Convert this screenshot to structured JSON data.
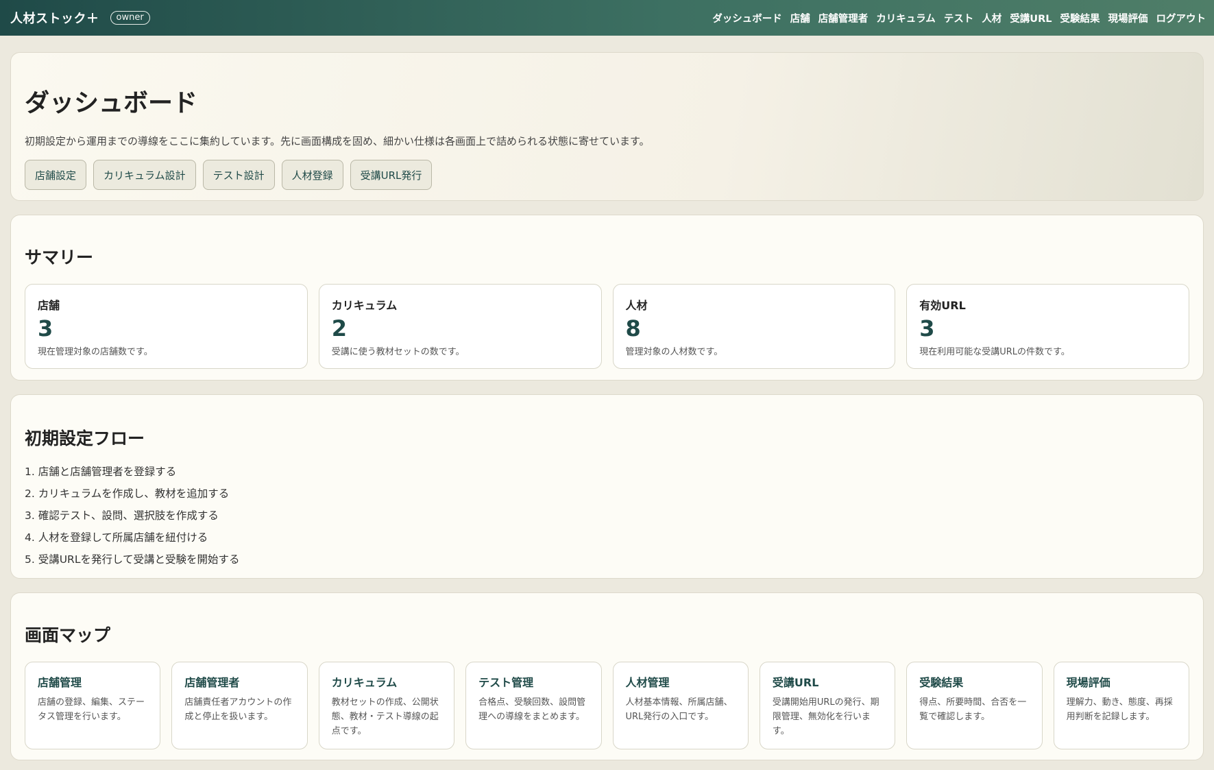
{
  "app": {
    "name": "人材ストック＋",
    "role": "owner"
  },
  "nav": [
    "ダッシュボード",
    "店舗",
    "店舗管理者",
    "カリキュラム",
    "テスト",
    "人材",
    "受講URL",
    "受験結果",
    "現場評価",
    "ログアウト"
  ],
  "hero": {
    "title": "ダッシュボード",
    "description": "初期設定から運用までの導線をここに集約しています。先に画面構成を固め、細かい仕様は各画面上で詰められる状態に寄せています。",
    "actions": [
      "店舗設定",
      "カリキュラム設計",
      "テスト設計",
      "人材登録",
      "受講URL発行"
    ]
  },
  "summary": {
    "title": "サマリー",
    "stats": [
      {
        "label": "店舗",
        "value": "3",
        "note": "現在管理対象の店舗数です。"
      },
      {
        "label": "カリキュラム",
        "value": "2",
        "note": "受講に使う教材セットの数です。"
      },
      {
        "label": "人材",
        "value": "8",
        "note": "管理対象の人材数です。"
      },
      {
        "label": "有効URL",
        "value": "3",
        "note": "現在利用可能な受講URLの件数です。"
      }
    ]
  },
  "flow": {
    "title": "初期設定フロー",
    "steps": [
      "1. 店舗と店舗管理者を登録する",
      "2. カリキュラムを作成し、教材を追加する",
      "3. 確認テスト、設問、選択肢を作成する",
      "4. 人材を登録して所属店舗を紐付ける",
      "5. 受講URLを発行して受講と受験を開始する"
    ]
  },
  "screen_map": {
    "title": "画面マップ",
    "cards": [
      {
        "title": "店舗管理",
        "desc": "店舗の登録、編集、ステータス管理を行います。"
      },
      {
        "title": "店舗管理者",
        "desc": "店舗責任者アカウントの作成と停止を扱います。"
      },
      {
        "title": "カリキュラム",
        "desc": "教材セットの作成、公開状態、教材・テスト導線の起点です。"
      },
      {
        "title": "テスト管理",
        "desc": "合格点、受験回数、設問管理への導線をまとめます。"
      },
      {
        "title": "人材管理",
        "desc": "人材基本情報、所属店舗、URL発行の入口です。"
      },
      {
        "title": "受講URL",
        "desc": "受講開始用URLの発行、期限管理、無効化を行います。"
      },
      {
        "title": "受験結果",
        "desc": "得点、所要時間、合否を一覧で確認します。"
      },
      {
        "title": "現場評価",
        "desc": "理解力、動き、態度、再採用判断を記録します。"
      }
    ]
  }
}
